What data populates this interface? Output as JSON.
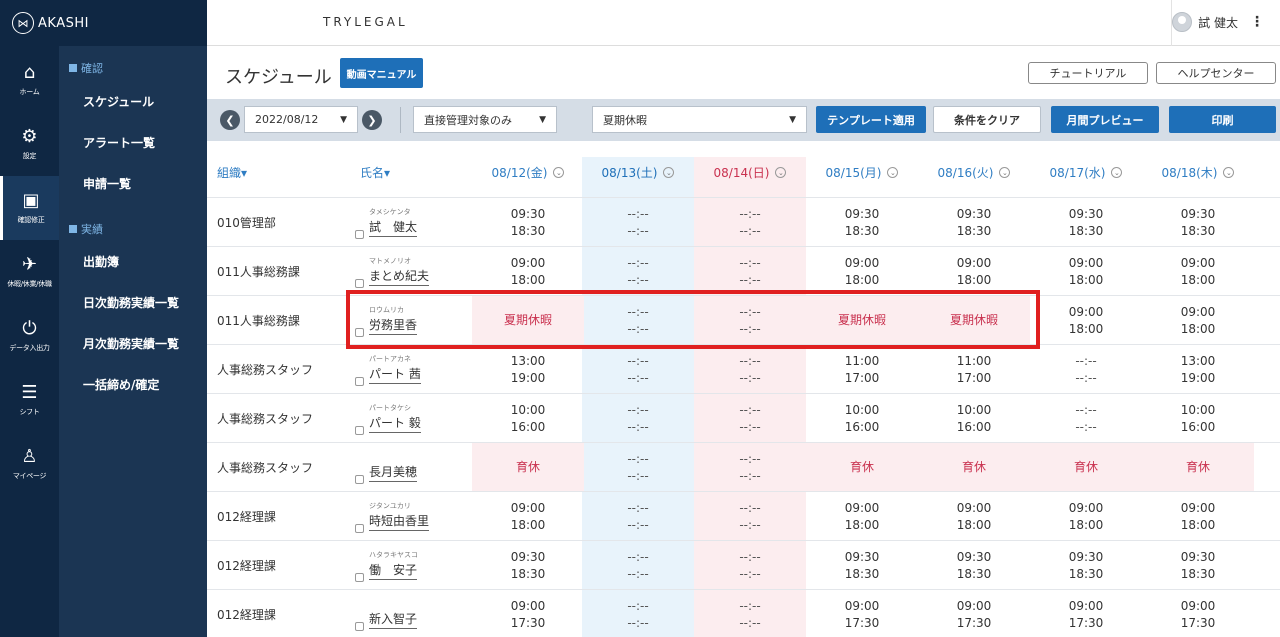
{
  "app": {
    "logo_text": "AKASHI",
    "brand": "TRYLEGAL",
    "user_name": "試 健太"
  },
  "rail": [
    {
      "icon": "home-icon",
      "glyph": "⌂",
      "label": "ホーム"
    },
    {
      "icon": "gear-icon",
      "glyph": "⚙",
      "label": "設定"
    },
    {
      "icon": "clipboard-icon",
      "glyph": "▣",
      "label": "確認修正"
    },
    {
      "icon": "leave-icon",
      "glyph": "✈",
      "label": "休暇/休業/休職"
    },
    {
      "icon": "data-io-icon",
      "glyph": "⏻",
      "label": "データ入出力"
    },
    {
      "icon": "shift-icon",
      "glyph": "☰",
      "label": "シフト"
    },
    {
      "icon": "person-icon",
      "glyph": "♙",
      "label": "マイページ"
    }
  ],
  "submenu": {
    "confirm_header": "確認",
    "confirm_items": [
      "スケジュール",
      "アラート一覧",
      "申請一覧"
    ],
    "results_header": "実績",
    "results_items": [
      "出勤簿",
      "日次勤務実績一覧",
      "月次勤務実績一覧",
      "一括締め/確定"
    ]
  },
  "page": {
    "title": "スケジュール",
    "manual_button": "動画マニュアル",
    "tutorial_button": "チュートリアル",
    "help_button": "ヘルプセンター"
  },
  "filters": {
    "date": "2022/08/12",
    "scope": "直接管理対象のみ",
    "template": "夏期休暇",
    "apply_template": "テンプレート適用",
    "clear": "条件をクリア",
    "month_preview": "月間プレビュー",
    "print": "印刷"
  },
  "table": {
    "col_org": "組織▾",
    "col_name": "氏名▾",
    "days": [
      {
        "label": "08/12(金)",
        "type": "weekday"
      },
      {
        "label": "08/13(土)",
        "type": "saturday"
      },
      {
        "label": "08/14(日)",
        "type": "sunday"
      },
      {
        "label": "08/15(月)",
        "type": "weekday"
      },
      {
        "label": "08/16(火)",
        "type": "weekday"
      },
      {
        "label": "08/17(水)",
        "type": "weekday"
      },
      {
        "label": "08/18(木)",
        "type": "weekday"
      }
    ],
    "rows": [
      {
        "org": "010管理部",
        "kana": "タメシケンタ",
        "name": "試　健太",
        "cells": [
          [
            "09:30",
            "18:30"
          ],
          [
            "--:--",
            "--:--"
          ],
          [
            "--:--",
            "--:--"
          ],
          [
            "09:30",
            "18:30"
          ],
          [
            "09:30",
            "18:30"
          ],
          [
            "09:30",
            "18:30"
          ],
          [
            "09:30",
            "18:30"
          ]
        ]
      },
      {
        "org": "011人事総務課",
        "kana": "マトメノリオ",
        "name": "まとめ紀夫",
        "cells": [
          [
            "09:00",
            "18:00"
          ],
          [
            "--:--",
            "--:--"
          ],
          [
            "--:--",
            "--:--"
          ],
          [
            "09:00",
            "18:00"
          ],
          [
            "09:00",
            "18:00"
          ],
          [
            "09:00",
            "18:00"
          ],
          [
            "09:00",
            "18:00"
          ]
        ]
      },
      {
        "org": "011人事総務課",
        "kana": "ロウムリカ",
        "name": "労務里香",
        "cells": [
          [
            "夏期休暇"
          ],
          [
            "--:--",
            "--:--"
          ],
          [
            "--:--",
            "--:--"
          ],
          [
            "夏期休暇"
          ],
          [
            "夏期休暇"
          ],
          [
            "09:00",
            "18:00"
          ],
          [
            "09:00",
            "18:00"
          ]
        ]
      },
      {
        "org": "人事総務スタッフ",
        "kana": "パートアカネ",
        "name": "パート 茜",
        "cells": [
          [
            "13:00",
            "19:00"
          ],
          [
            "--:--",
            "--:--"
          ],
          [
            "--:--",
            "--:--"
          ],
          [
            "11:00",
            "17:00"
          ],
          [
            "11:00",
            "17:00"
          ],
          [
            "--:--",
            "--:--"
          ],
          [
            "13:00",
            "19:00"
          ]
        ]
      },
      {
        "org": "人事総務スタッフ",
        "kana": "パートタケシ",
        "name": "パート 毅",
        "cells": [
          [
            "10:00",
            "16:00"
          ],
          [
            "--:--",
            "--:--"
          ],
          [
            "--:--",
            "--:--"
          ],
          [
            "10:00",
            "16:00"
          ],
          [
            "10:00",
            "16:00"
          ],
          [
            "--:--",
            "--:--"
          ],
          [
            "10:00",
            "16:00"
          ]
        ]
      },
      {
        "org": "人事総務スタッフ",
        "kana": "",
        "name": "長月美穂",
        "cells": [
          [
            "育休"
          ],
          [
            "--:--",
            "--:--"
          ],
          [
            "--:--",
            "--:--"
          ],
          [
            "育休"
          ],
          [
            "育休"
          ],
          [
            "育休"
          ],
          [
            "育休"
          ]
        ]
      },
      {
        "org": "012経理課",
        "kana": "ジタンユカリ",
        "name": "時短由香里",
        "cells": [
          [
            "09:00",
            "18:00"
          ],
          [
            "--:--",
            "--:--"
          ],
          [
            "--:--",
            "--:--"
          ],
          [
            "09:00",
            "18:00"
          ],
          [
            "09:00",
            "18:00"
          ],
          [
            "09:00",
            "18:00"
          ],
          [
            "09:00",
            "18:00"
          ]
        ]
      },
      {
        "org": "012経理課",
        "kana": "ハタラキヤスコ",
        "name": "働　安子",
        "cells": [
          [
            "09:30",
            "18:30"
          ],
          [
            "--:--",
            "--:--"
          ],
          [
            "--:--",
            "--:--"
          ],
          [
            "09:30",
            "18:30"
          ],
          [
            "09:30",
            "18:30"
          ],
          [
            "09:30",
            "18:30"
          ],
          [
            "09:30",
            "18:30"
          ]
        ]
      },
      {
        "org": "012経理課",
        "kana": "",
        "name": "新入智子",
        "cells": [
          [
            "09:00",
            "17:30"
          ],
          [
            "--:--",
            "--:--"
          ],
          [
            "--:--",
            "--:--"
          ],
          [
            "09:00",
            "17:30"
          ],
          [
            "09:00",
            "17:30"
          ],
          [
            "09:00",
            "17:30"
          ],
          [
            "09:00",
            "17:30"
          ]
        ]
      }
    ]
  },
  "colors": {
    "saturday_bg": "#e8f3fb",
    "sunday_bg": "#fcedef",
    "leave_bg": "#fcedef",
    "leave_text": "#c9314f",
    "accent": "#1e6fb8",
    "highlight": "#e02020"
  }
}
